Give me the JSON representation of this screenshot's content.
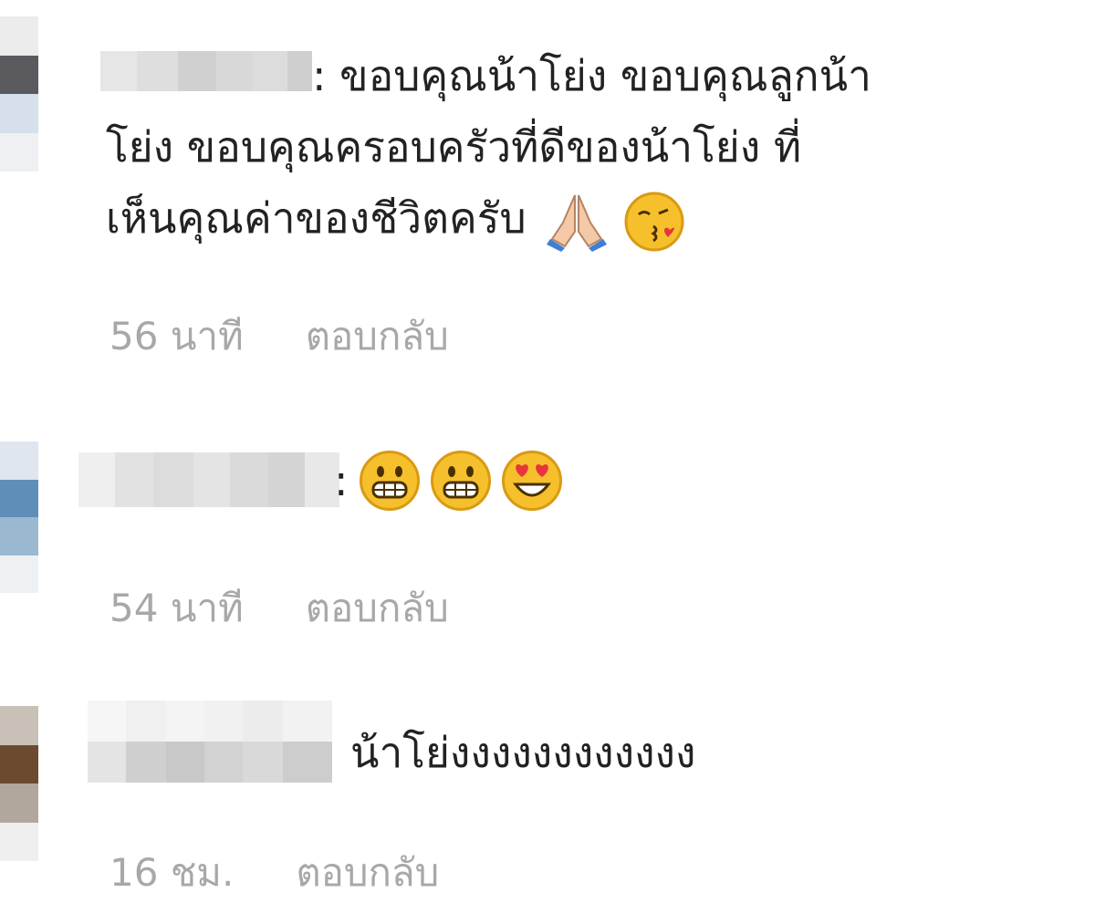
{
  "comments": [
    {
      "colon": ":",
      "line1": "ขอบคุณน้าโย่ง ขอบคุณลูกน้า",
      "line2": "โย่ง ขอบคุณครอบครัวที่ดีของน้าโย่ง ที่",
      "line3": "เห็นคุณค่าของชีวิตครับ",
      "emojis": [
        "folded-hands-icon",
        "face-blowing-kiss-icon"
      ],
      "time": "56 นาที",
      "reply": "ตอบกลับ"
    },
    {
      "colon": ":",
      "emojis": [
        "grinning-face-icon",
        "grinning-face-icon",
        "heart-eyes-face-icon"
      ],
      "time": "54 นาที",
      "reply": "ตอบกลับ"
    },
    {
      "text": "น้าโย่งงงงงงงงงงงง",
      "time": "16 ชม.",
      "reply": "ตอบกลับ"
    }
  ],
  "colors": {
    "text": "#222222",
    "meta": "#a8a8a8",
    "emoji_yellow": "#f6c02c",
    "heart_red": "#e8343d"
  }
}
